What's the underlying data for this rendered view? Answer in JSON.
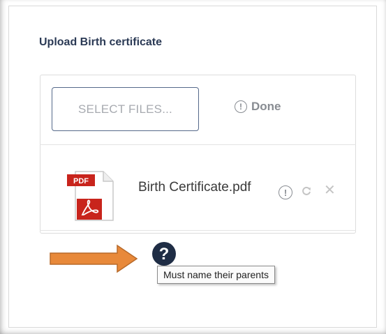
{
  "upload": {
    "title": "Upload Birth certificate",
    "select_label": "SELECT FILES...",
    "status_label": "Done",
    "status_icon_glyph": "!"
  },
  "file": {
    "name": "Birth Certificate.pdf",
    "type_badge": "PDF",
    "alert_glyph": "!",
    "remove_glyph": "✕",
    "icon": "pdf-file-icon"
  },
  "help": {
    "glyph": "?",
    "tooltip": "Must name their parents",
    "icon": "help-icon"
  },
  "colors": {
    "title": "#2b3a55",
    "button_border": "#55698a",
    "pdf_red": "#c8241c",
    "arrow_orange": "#e8893a",
    "help_dark": "#1f2d45"
  }
}
